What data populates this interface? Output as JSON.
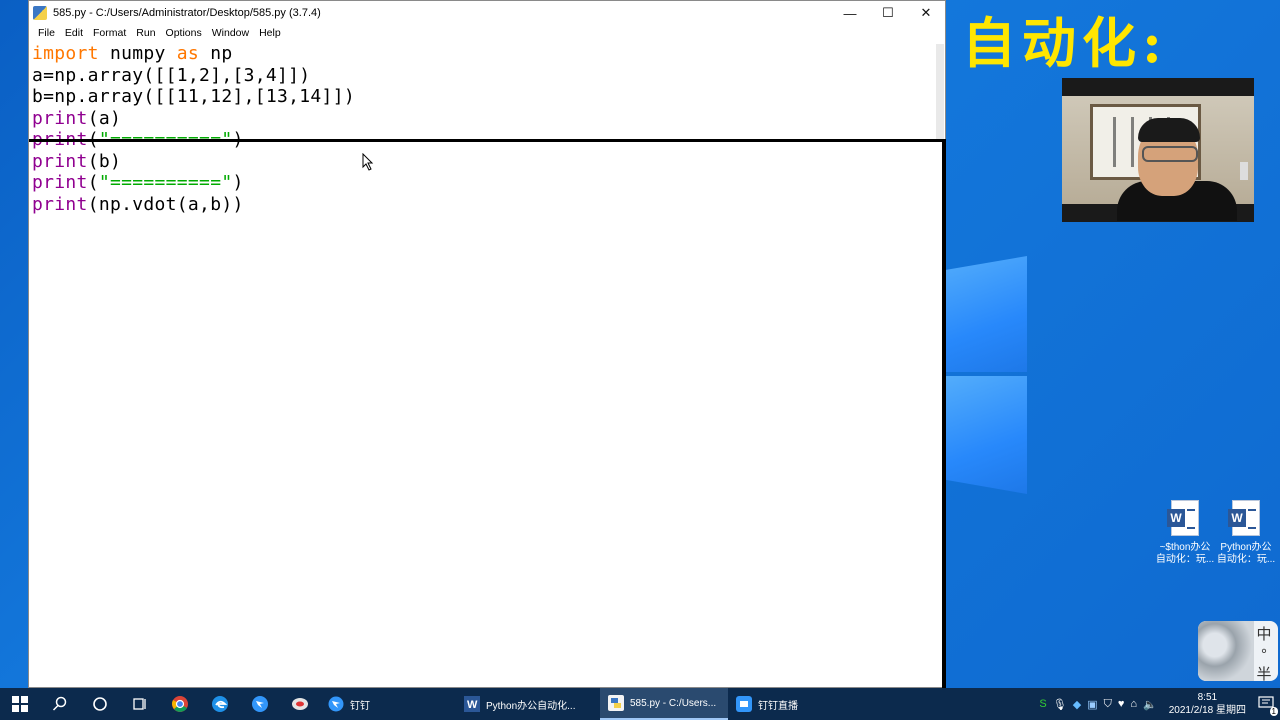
{
  "window": {
    "title": "585.py - C:/Users/Administrator/Desktop/585.py (3.7.4)",
    "minimize_glyph": "—",
    "maximize_glyph": "☐",
    "close_glyph": "✕"
  },
  "menu": {
    "file": "File",
    "edit": "Edit",
    "format": "Format",
    "run": "Run",
    "options": "Options",
    "window": "Window",
    "help": "Help"
  },
  "code": {
    "line1": {
      "kw1": "import",
      "t1": " numpy ",
      "kw2": "as",
      "t2": " np"
    },
    "line2": "a=np.array([[1,2],[3,4]])",
    "line3": "b=np.array([[11,12],[13,14]])",
    "line4": {
      "fn": "print",
      "rest": "(a)"
    },
    "line5": {
      "fn": "print",
      "open": "(",
      "str": "\"==========\"",
      "close": ")"
    },
    "line6": {
      "fn": "print",
      "rest": "(b)"
    },
    "line7": {
      "fn": "print",
      "open": "(",
      "str": "\"==========\"",
      "close": ")"
    },
    "line8": {
      "fn": "print",
      "rest": "(np.vdot(a,b))"
    }
  },
  "desktop": {
    "banner": "自动化:",
    "icons": [
      {
        "label_line1": "~$thon办公",
        "label_line2": "自动化：玩..."
      },
      {
        "label_line1": "Python办公",
        "label_line2": "自动化：玩..."
      }
    ],
    "ime": {
      "char1": "中",
      "char2": "°",
      "char3": "半"
    }
  },
  "taskbar": {
    "start_icon": "windows-start-icon",
    "apps": [
      {
        "label": "钉钉",
        "icon": "dingtalk-icon"
      },
      {
        "label": "Python办公自动化...",
        "icon": "word-icon"
      },
      {
        "label": "585.py - C:/Users...",
        "icon": "python-idle-icon"
      },
      {
        "label": "钉钉直播",
        "icon": "dingtalk-live-icon"
      }
    ],
    "clock_time": "8:51",
    "clock_date": "2021/2/18 星期四",
    "notification_count": "1"
  },
  "colors": {
    "keyword": "#ff7700",
    "builtin": "#900090",
    "string": "#00aa00",
    "banner": "#ffe600",
    "taskbar": "#0c2a4d"
  }
}
